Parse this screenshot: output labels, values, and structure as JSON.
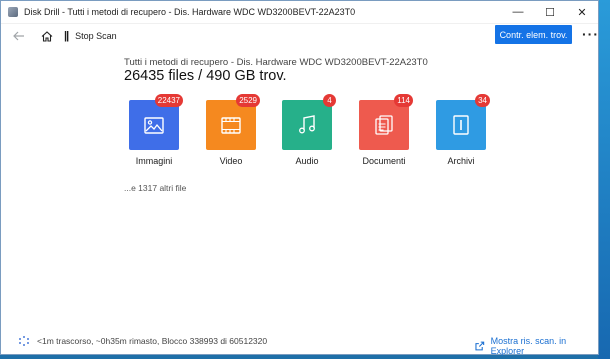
{
  "window": {
    "title": "Disk Drill - Tutti i metodi di recupero - Dis. Hardware WDC WD3200BEVT-22A23T0",
    "minimize": "—",
    "maximize": "☐",
    "close": "✕"
  },
  "toolbar": {
    "stop_label": "Stop Scan",
    "primary_button": "Contr. elem. trov.",
    "more": "···"
  },
  "main": {
    "subtitle": "Tutti i metodi di recupero - Dis. Hardware WDC WD3200BEVT-22A23T0",
    "headline": "26435 files / 490 GB trov.",
    "categories": [
      {
        "label": "Immagini",
        "count": "22437",
        "color": "#3f6ee8",
        "icon": "image-icon"
      },
      {
        "label": "Video",
        "count": "2529",
        "color": "#f5891f",
        "icon": "video-icon"
      },
      {
        "label": "Audio",
        "count": "4",
        "color": "#26b08a",
        "icon": "music-icon"
      },
      {
        "label": "Documenti",
        "count": "114",
        "color": "#ee5a4e",
        "icon": "document-icon"
      },
      {
        "label": "Archivi",
        "count": "34",
        "color": "#2f9be3",
        "icon": "archive-icon"
      }
    ],
    "more_files": "...e 1317 altri file"
  },
  "statusbar": {
    "progress": "<1m trascorso, ~0h35m rimasto, Blocco 338993 di 60512320",
    "explorer_link": "Mostra ris. scan. in Explorer"
  }
}
